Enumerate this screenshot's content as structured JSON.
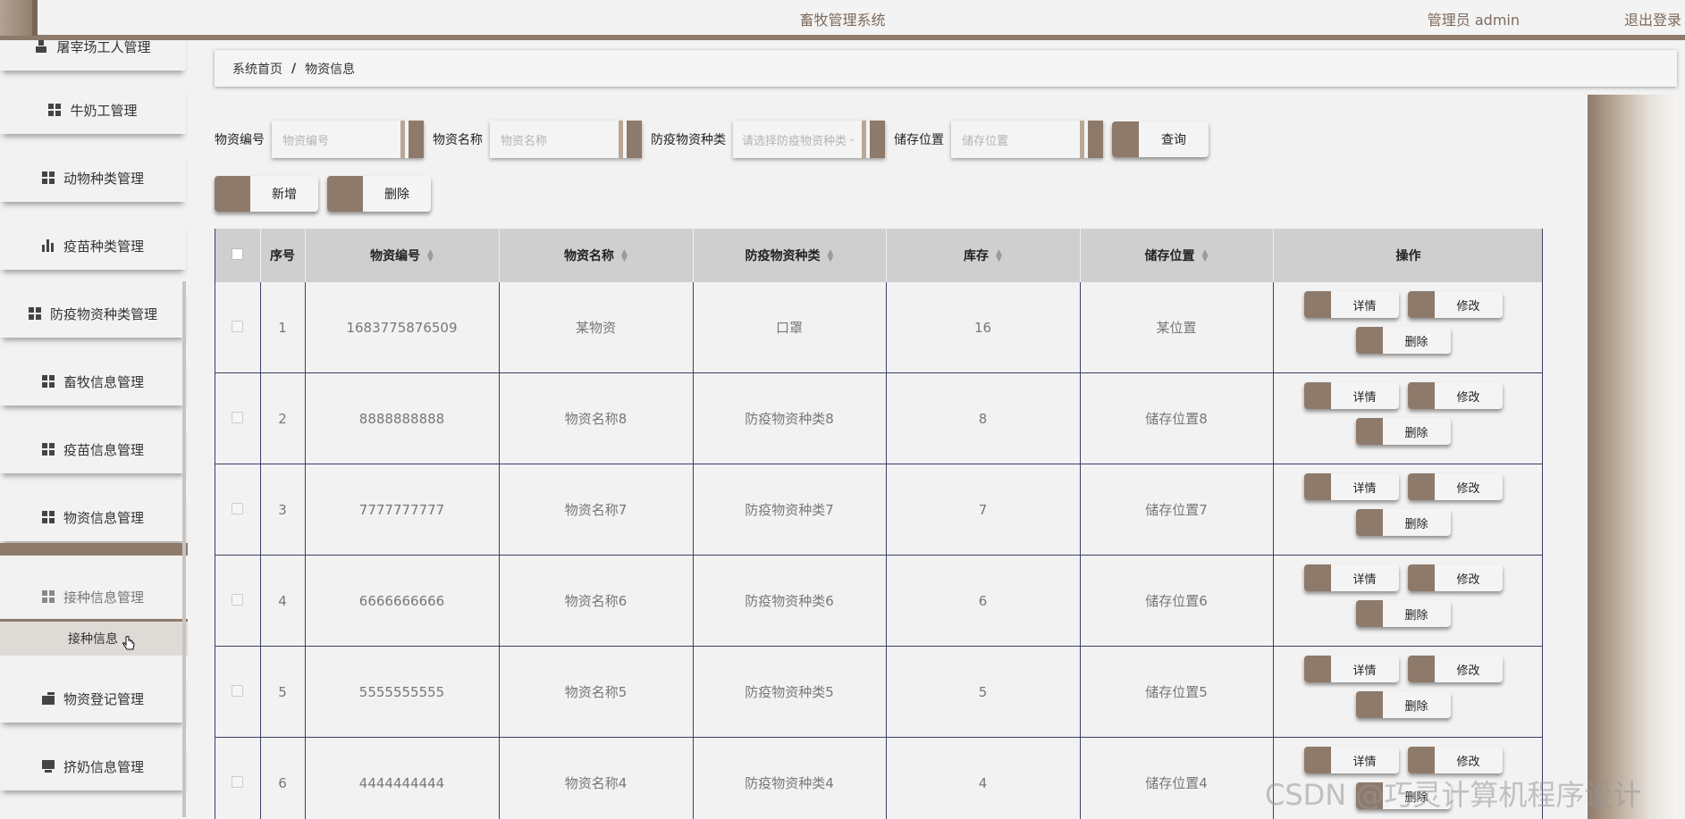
{
  "header": {
    "title": "畜牧管理系统",
    "user": "管理员 admin",
    "logout": "退出登录"
  },
  "sidebar": {
    "items": [
      {
        "label": "屠宰场工人管理",
        "icon": "person-icon"
      },
      {
        "label": "牛奶工管理",
        "icon": "grid-icon"
      },
      {
        "label": "动物种类管理",
        "icon": "grid-icon"
      },
      {
        "label": "疫苗种类管理",
        "icon": "bar-chart-icon"
      },
      {
        "label": "防疫物资种类管理",
        "icon": "grid-icon"
      },
      {
        "label": "畜牧信息管理",
        "icon": "grid-icon"
      },
      {
        "label": "疫苗信息管理",
        "icon": "grid-icon"
      },
      {
        "label": "物资信息管理",
        "icon": "grid-icon"
      },
      {
        "label": "接种信息管理",
        "icon": "grid-icon"
      },
      {
        "label": "物资登记管理",
        "icon": "wallet-icon"
      },
      {
        "label": "挤奶信息管理",
        "icon": "monitor-icon"
      }
    ],
    "submenu_item": "接种信息"
  },
  "breadcrumb": {
    "home": "系统首页",
    "separator": "/",
    "current": "物资信息"
  },
  "search": {
    "code_label": "物资编号",
    "code_placeholder": "物资编号",
    "name_label": "物资名称",
    "name_placeholder": "物资名称",
    "type_label": "防疫物资种类",
    "type_placeholder": "请选择防疫物资种类",
    "location_label": "储存位置",
    "location_placeholder": "储存位置",
    "query_button": "查询"
  },
  "actions": {
    "add": "新增",
    "delete": "删除"
  },
  "table": {
    "headers": [
      "序号",
      "物资编号",
      "物资名称",
      "防疫物资种类",
      "库存",
      "储存位置",
      "操作"
    ],
    "row_buttons": {
      "detail": "详情",
      "edit": "修改",
      "delete": "删除"
    },
    "rows": [
      {
        "index": "1",
        "code": "1683775876509",
        "name": "某物资",
        "type": "口罩",
        "stock": "16",
        "location": "某位置"
      },
      {
        "index": "2",
        "code": "8888888888",
        "name": "物资名称8",
        "type": "防疫物资种类8",
        "stock": "8",
        "location": "储存位置8"
      },
      {
        "index": "3",
        "code": "7777777777",
        "name": "物资名称7",
        "type": "防疫物资种类7",
        "stock": "7",
        "location": "储存位置7"
      },
      {
        "index": "4",
        "code": "6666666666",
        "name": "物资名称6",
        "type": "防疫物资种类6",
        "stock": "6",
        "location": "储存位置6"
      },
      {
        "index": "5",
        "code": "5555555555",
        "name": "物资名称5",
        "type": "防疫物资种类5",
        "stock": "5",
        "location": "储存位置5"
      },
      {
        "index": "6",
        "code": "4444444444",
        "name": "物资名称4",
        "type": "防疫物资种类4",
        "stock": "4",
        "location": "储存位置4"
      }
    ]
  },
  "watermark": "CSDN @巧灵计算机程序设计",
  "colors": {
    "accent": "#8e7a6b",
    "header_bg": "#cfcfcf",
    "grid_line": "#3a3f66"
  }
}
